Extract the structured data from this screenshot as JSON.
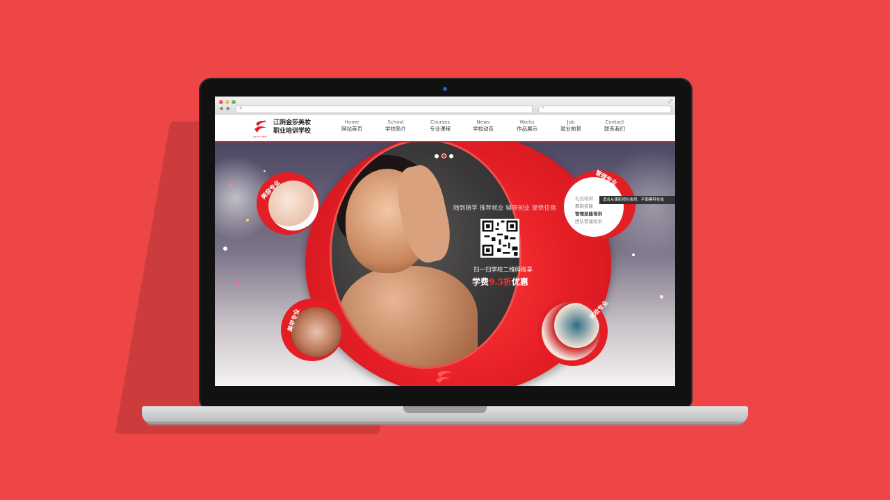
{
  "colors": {
    "background": "#ee4646",
    "brand_red": "#e41e25",
    "dark": "#2a2828"
  },
  "browser": {
    "address_icon": "+",
    "search_icon": "search-icon"
  },
  "site": {
    "name_line1": "江阴金莎美妆",
    "name_line2": "职业培训学校",
    "logo_sub": "JINSHA NEW",
    "nav": [
      {
        "en": "Home",
        "zh": "网站首页"
      },
      {
        "en": "School",
        "zh": "学校简介"
      },
      {
        "en": "Courses",
        "zh": "专业课程"
      },
      {
        "en": "News",
        "zh": "学校动态"
      },
      {
        "en": "Works",
        "zh": "作品展示"
      },
      {
        "en": "Job",
        "zh": "就业前景"
      },
      {
        "en": "Contact",
        "zh": "联系我们"
      }
    ]
  },
  "banner": {
    "tagline": "随到随学 推荐就业 辅导创业 提供住宿",
    "scan_text": "扫一扫学校二维码既享",
    "fee_prefix": "学费",
    "fee_discount": "9.5折",
    "fee_suffix": "优惠",
    "slides": 3,
    "active_slide": 2,
    "labels": {
      "beauty": "美容专业",
      "nail": "美甲专业",
      "management": "管理专业",
      "makeup": "化妆专业"
    },
    "courses": [
      {
        "label": "礼仪培训",
        "active": false
      },
      {
        "label": "舞蹈技能",
        "active": false
      },
      {
        "label": "管理技能培训",
        "active": true
      },
      {
        "label": "团队管理培训",
        "active": false
      }
    ],
    "tooltip": "适合从事影视化妆师、平面模特化妆"
  }
}
